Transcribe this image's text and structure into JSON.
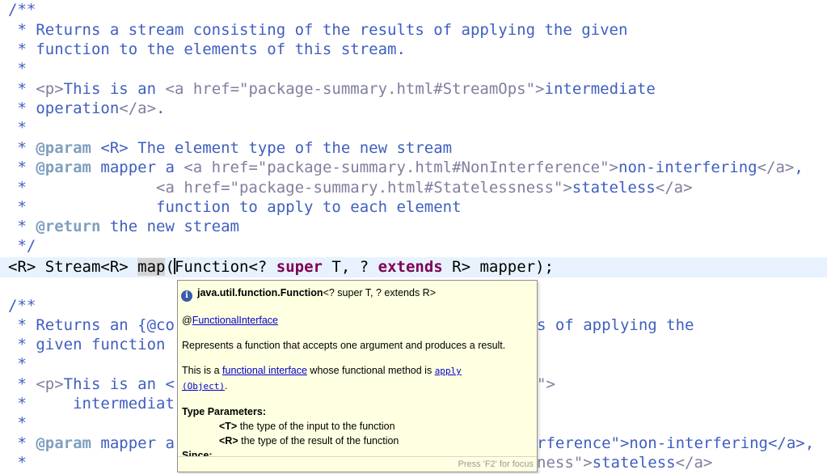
{
  "editor": {
    "javadoc1": {
      "open": "/**",
      "l1_star": " * ",
      "l1_text": "Returns a stream consisting of the results of applying the given",
      "l2_text": "function to the elements of this stream.",
      "l3": " *",
      "l4_tag": "<p>",
      "l4_text": "This is an ",
      "l4_a": "<a href=\"package-summary.html#StreamOps\">",
      "l4_text2": "intermediate",
      "l5_text": "operation",
      "l5_a": "</a>",
      "l5_dot": ".",
      "l6": " *",
      "l7_kw": "@param",
      "l7_text": " <R> The element type of the new stream",
      "l8_kw": "@param",
      "l8_text": " mapper a ",
      "l8_a": "<a href=\"package-summary.html#NonInterference\">",
      "l8_text2": "non-interfering",
      "l8_a2": "</a>",
      "l8_comma": ",",
      "l9_pad": " *              ",
      "l9_a": "<a href=\"package-summary.html#Statelessness\">",
      "l9_text": "stateless",
      "l9_a2": "</a>",
      "l10_pad": " *              ",
      "l10_text": "function to apply to each element",
      "l11_kw": "@return",
      "l11_text": " the new stream",
      "close": " */"
    },
    "signature": {
      "p1": "<R> Stream<R> ",
      "method": "map",
      "p2": "(",
      "p3": "F",
      "p4": "unction<? ",
      "kw1": "super",
      "p5": " T, ? ",
      "kw2": "extends",
      "p6": " R> mapper);"
    },
    "javadoc2": {
      "open": "/**",
      "l1_text": "Returns an {@co",
      "l1_right": "s of applying the",
      "l2_text": "given function",
      "l3": " *",
      "l4_tag": "<p>",
      "l4_text": "This is an <",
      "l4_right": "\">",
      "l5_pad": " *     ",
      "l5_text": "intermediat",
      "l6": " *",
      "l7_kw": "@param",
      "l7_text": " mapper a",
      "l7_right": "rference\">non-interfering</a>,",
      "l8_pad": " *",
      "l8_right_a": "ness\">",
      "l8_right_text": "stateless",
      "l8_right_a2": "</a>"
    }
  },
  "hover": {
    "header": "java.util.function.Function",
    "header_generic": "<? super T, ? extends R>",
    "annotation_at": "@",
    "annotation_link": "FunctionalInterface",
    "description": "Represents a function that accepts one argument and produces a result.",
    "fi_pre": "This is a ",
    "fi_link": "functional interface",
    "fi_mid": " whose functional method is ",
    "fi_method": "apply",
    "fi_method_args": "(Object)",
    "fi_end": ".",
    "type_params_title": "Type Parameters:",
    "tp1_name": "<T>",
    "tp1_desc": " the type of the input to the function",
    "tp2_name": "<R>",
    "tp2_desc": " the type of the result of the function",
    "since_title": "Since:",
    "footer": "Press 'F2' for focus"
  }
}
